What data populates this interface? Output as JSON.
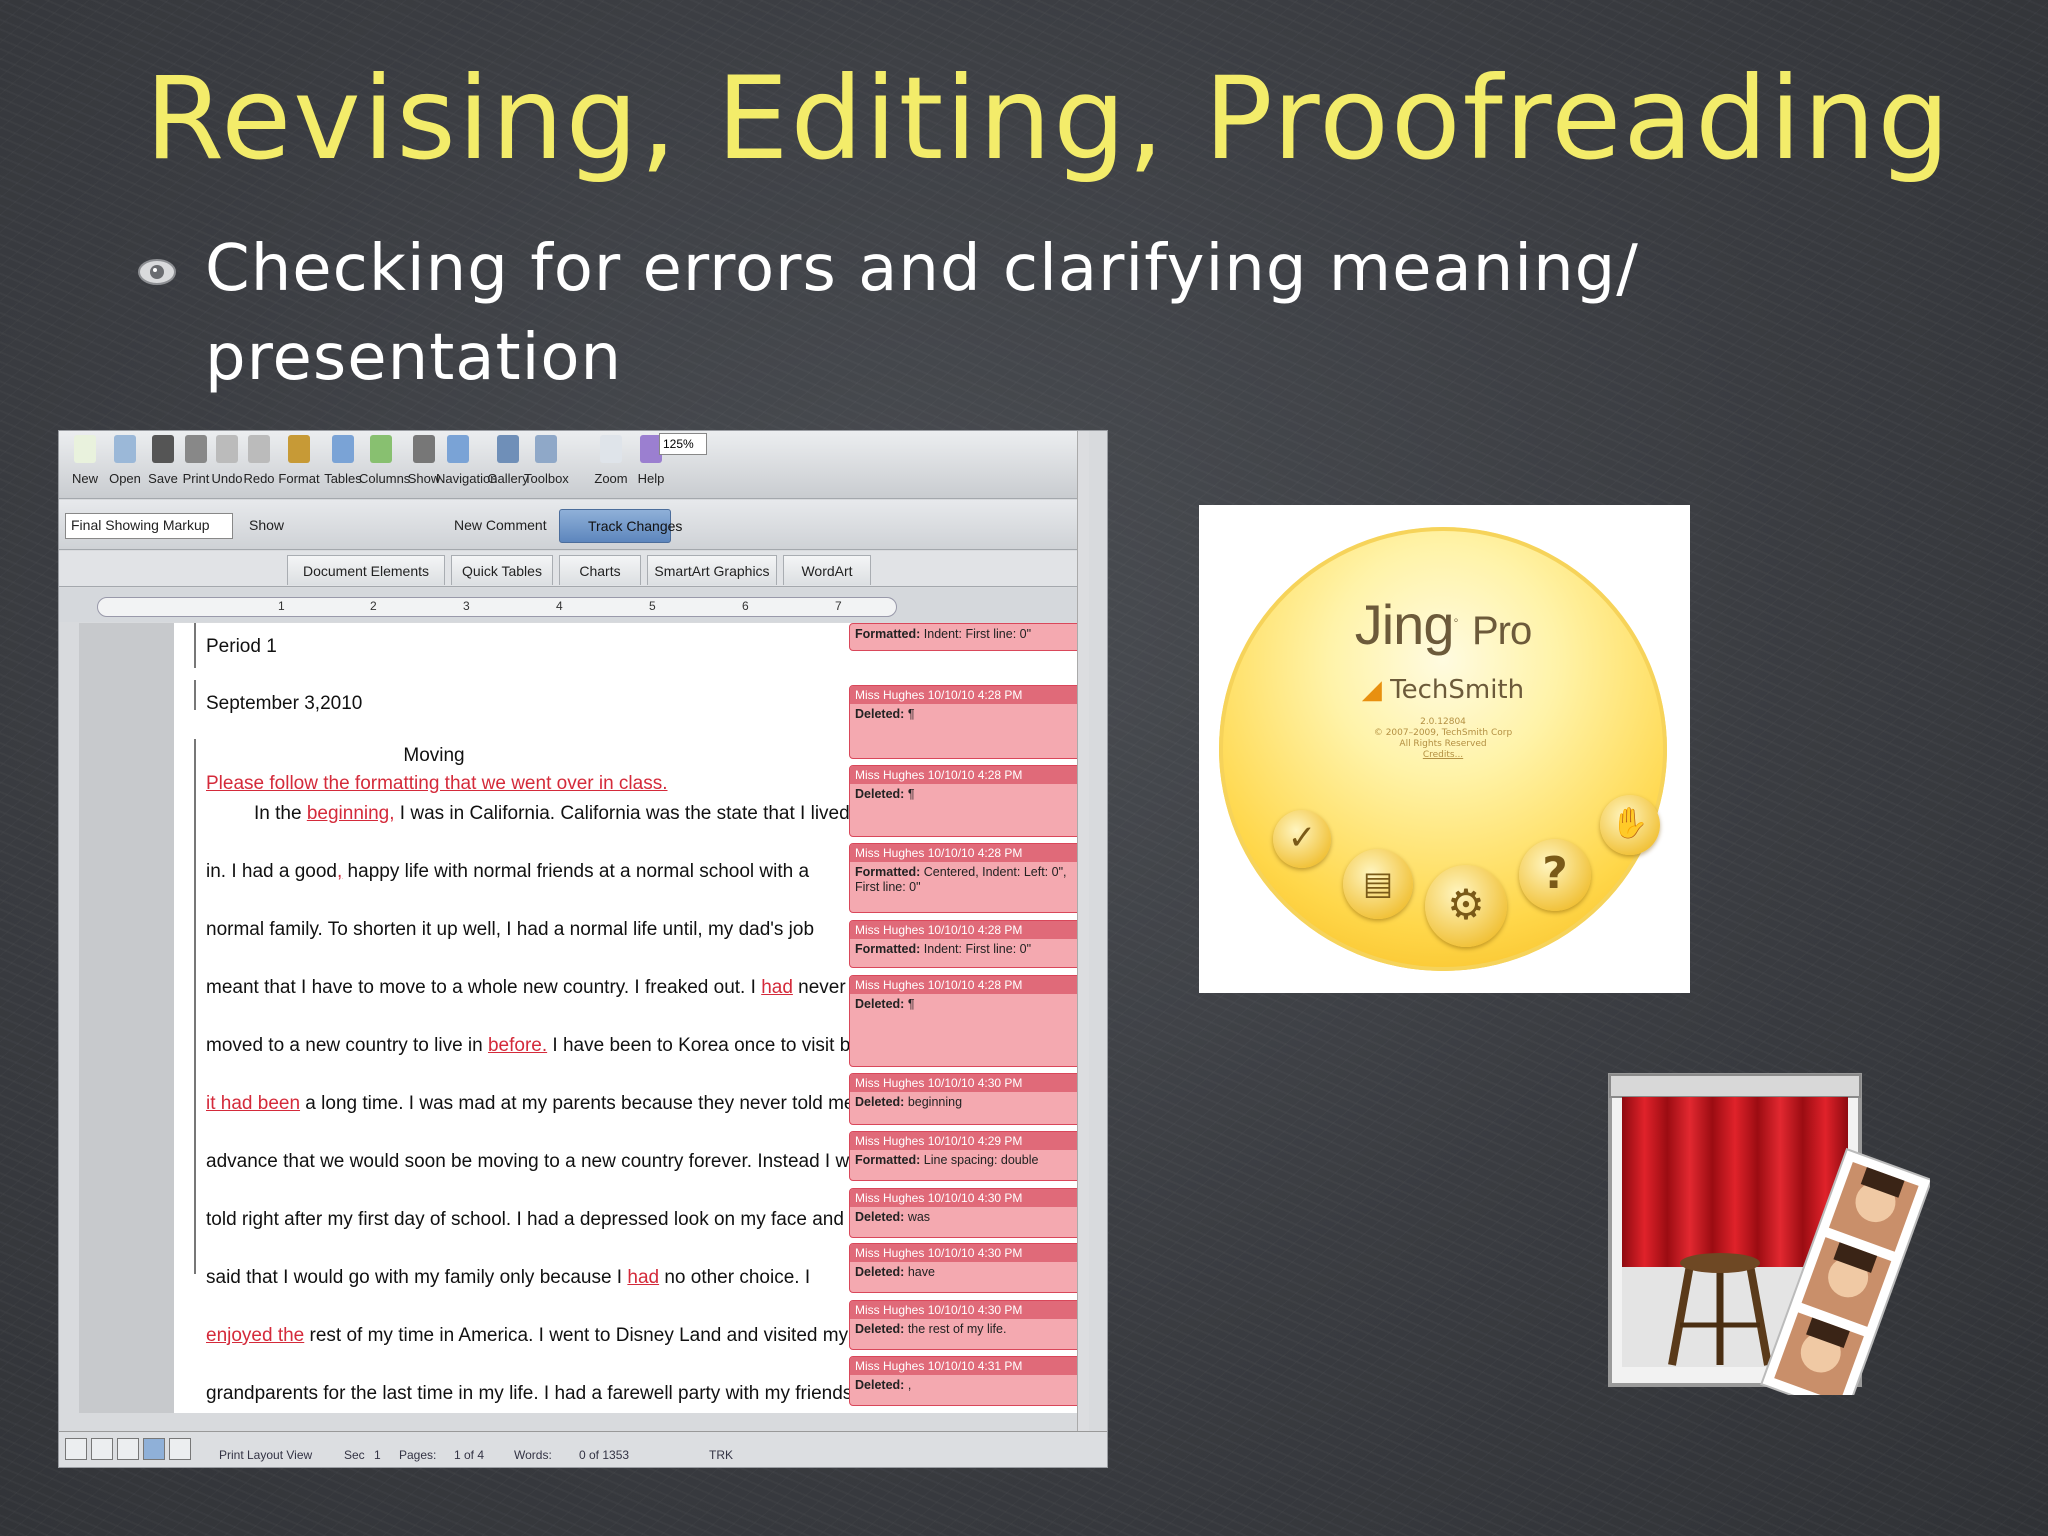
{
  "slide": {
    "title": "Revising, Editing, Proofreading",
    "bullet": "Checking for errors and clarifying meaning/ presentation"
  },
  "word": {
    "toolbar": [
      {
        "label": "New",
        "icon": "new-document-icon"
      },
      {
        "label": "Open",
        "icon": "open-folder-icon"
      },
      {
        "label": "Save",
        "icon": "save-icon"
      },
      {
        "label": "Print",
        "icon": "print-icon"
      },
      {
        "label": "Undo",
        "icon": "undo-icon"
      },
      {
        "label": "Redo",
        "icon": "redo-icon"
      },
      {
        "label": "Format",
        "icon": "format-brush-icon"
      },
      {
        "label": "Tables",
        "icon": "table-icon"
      },
      {
        "label": "Columns",
        "icon": "columns-icon"
      },
      {
        "label": "Show",
        "icon": "pilcrow-icon"
      },
      {
        "label": "Navigation",
        "icon": "navigation-pane-icon"
      },
      {
        "label": "Gallery",
        "icon": "gallery-icon"
      },
      {
        "label": "Toolbox",
        "icon": "toolbox-icon"
      },
      {
        "label": "Zoom",
        "icon": "zoom-icon"
      },
      {
        "label": "Help",
        "icon": "help-icon"
      }
    ],
    "zoom_value": "125%",
    "markup_select": "Final Showing Markup",
    "show_label": "Show",
    "new_comment_label": "New Comment",
    "track_changes_label": "Track Changes",
    "ribbon_tabs": [
      "Document Elements",
      "Quick Tables",
      "Charts",
      "SmartArt Graphics",
      "WordArt"
    ],
    "ruler_numbers": [
      "1",
      "2",
      "3",
      "4",
      "5",
      "6",
      "7"
    ],
    "doc": {
      "period": "Period 1",
      "date": "September 3,2010",
      "heading": "Moving",
      "comment_line": "Please follow the formatting that we went over in class.",
      "lines": [
        {
          "pre": "In the ",
          "ins": "beginning,",
          "post": " I was in California.  California was the state that I lived"
        },
        {
          "pre": "in. I had a good",
          "ins": ",",
          "post": " happy life with normal friends at a normal school with a"
        },
        {
          "pre": "normal family. To shorten it up well, I had a normal life until, my dad's job",
          "ins": "",
          "post": ""
        },
        {
          "pre": "meant that I have to move to a whole new country. I freaked out.  I ",
          "ins": "had",
          "post": " never"
        },
        {
          "pre": "moved to a new country to live in ",
          "ins": "before.",
          "post": " I have been to Korea once to visit but"
        },
        {
          "pre": "",
          "ins": "it had been",
          "post": " a long time.  I was mad at my parents because they never told me in"
        },
        {
          "pre": "advance that we would soon be moving to a new country forever.  Instead I was",
          "ins": "",
          "post": ""
        },
        {
          "pre": "told right after my first day of school. I had a depressed look on my face and",
          "ins": "",
          "post": ""
        },
        {
          "pre": "said that I would go with my family only because I ",
          "ins": "had",
          "post": " no other choice.  I"
        },
        {
          "pre": "",
          "ins": "enjoyed the",
          "post": " rest of my time in America. I went to Disney Land and visited my"
        },
        {
          "pre": "grandparents for the last time in my life. I had a farewell party with my friends. I",
          "ins": "",
          "post": ""
        }
      ]
    },
    "balloons": [
      {
        "header": "",
        "body_label": "Formatted:",
        "body": "Indent: First line:  0\""
      },
      {
        "header": "Miss Hughes 10/10/10 4:28 PM",
        "body_label": "Deleted:",
        "body": "¶"
      },
      {
        "header": "Miss Hughes 10/10/10 4:28 PM",
        "body_label": "Deleted:",
        "body": "¶"
      },
      {
        "header": "Miss Hughes 10/10/10 4:28 PM",
        "body_label": "Formatted:",
        "body": "Centered, Indent: Left:  0\", First line:  0\""
      },
      {
        "header": "Miss Hughes 10/10/10 4:28 PM",
        "body_label": "Formatted:",
        "body": "Indent: First line:  0\""
      },
      {
        "header": "Miss Hughes 10/10/10 4:28 PM",
        "body_label": "Deleted:",
        "body": "¶"
      },
      {
        "header": "Miss Hughes 10/10/10 4:30 PM",
        "body_label": "Deleted:",
        "body": "beginning"
      },
      {
        "header": "Miss Hughes 10/10/10 4:29 PM",
        "body_label": "Formatted:",
        "body": "Line spacing:  double"
      },
      {
        "header": "Miss Hughes 10/10/10 4:30 PM",
        "body_label": "Deleted:",
        "body": "was"
      },
      {
        "header": "Miss Hughes 10/10/10 4:30 PM",
        "body_label": "Deleted:",
        "body": "have"
      },
      {
        "header": "Miss Hughes 10/10/10 4:30 PM",
        "body_label": "Deleted:",
        "body": "the rest of my life."
      },
      {
        "header": "Miss Hughes 10/10/10 4:31 PM",
        "body_label": "Deleted:",
        "body": ","
      }
    ],
    "status": {
      "view": "Print Layout View",
      "sec_label": "Sec",
      "sec": "1",
      "pages_label": "Pages:",
      "pages": "1 of 4",
      "words_label": "Words:",
      "words": "0 of 1353",
      "trk": "TRK"
    }
  },
  "jing": {
    "name": "Jing",
    "pro": "Pro",
    "company": "TechSmith",
    "version": "2.0.12804",
    "copyright": "© 2007–2009, TechSmith Corp",
    "rights": "All Rights Reserved",
    "credits": "Credits...",
    "buttons": [
      "check-icon",
      "history-icon",
      "gear-icon",
      "help-icon",
      "exit-icon"
    ]
  },
  "photobooth": {
    "icon": "photo-booth-icon"
  },
  "colors": {
    "title": "#f3ec6a",
    "bullet": "#ffffff",
    "background": "#3a3c41",
    "track_change": "#d42a3a",
    "balloon": "#f4a9b0"
  }
}
